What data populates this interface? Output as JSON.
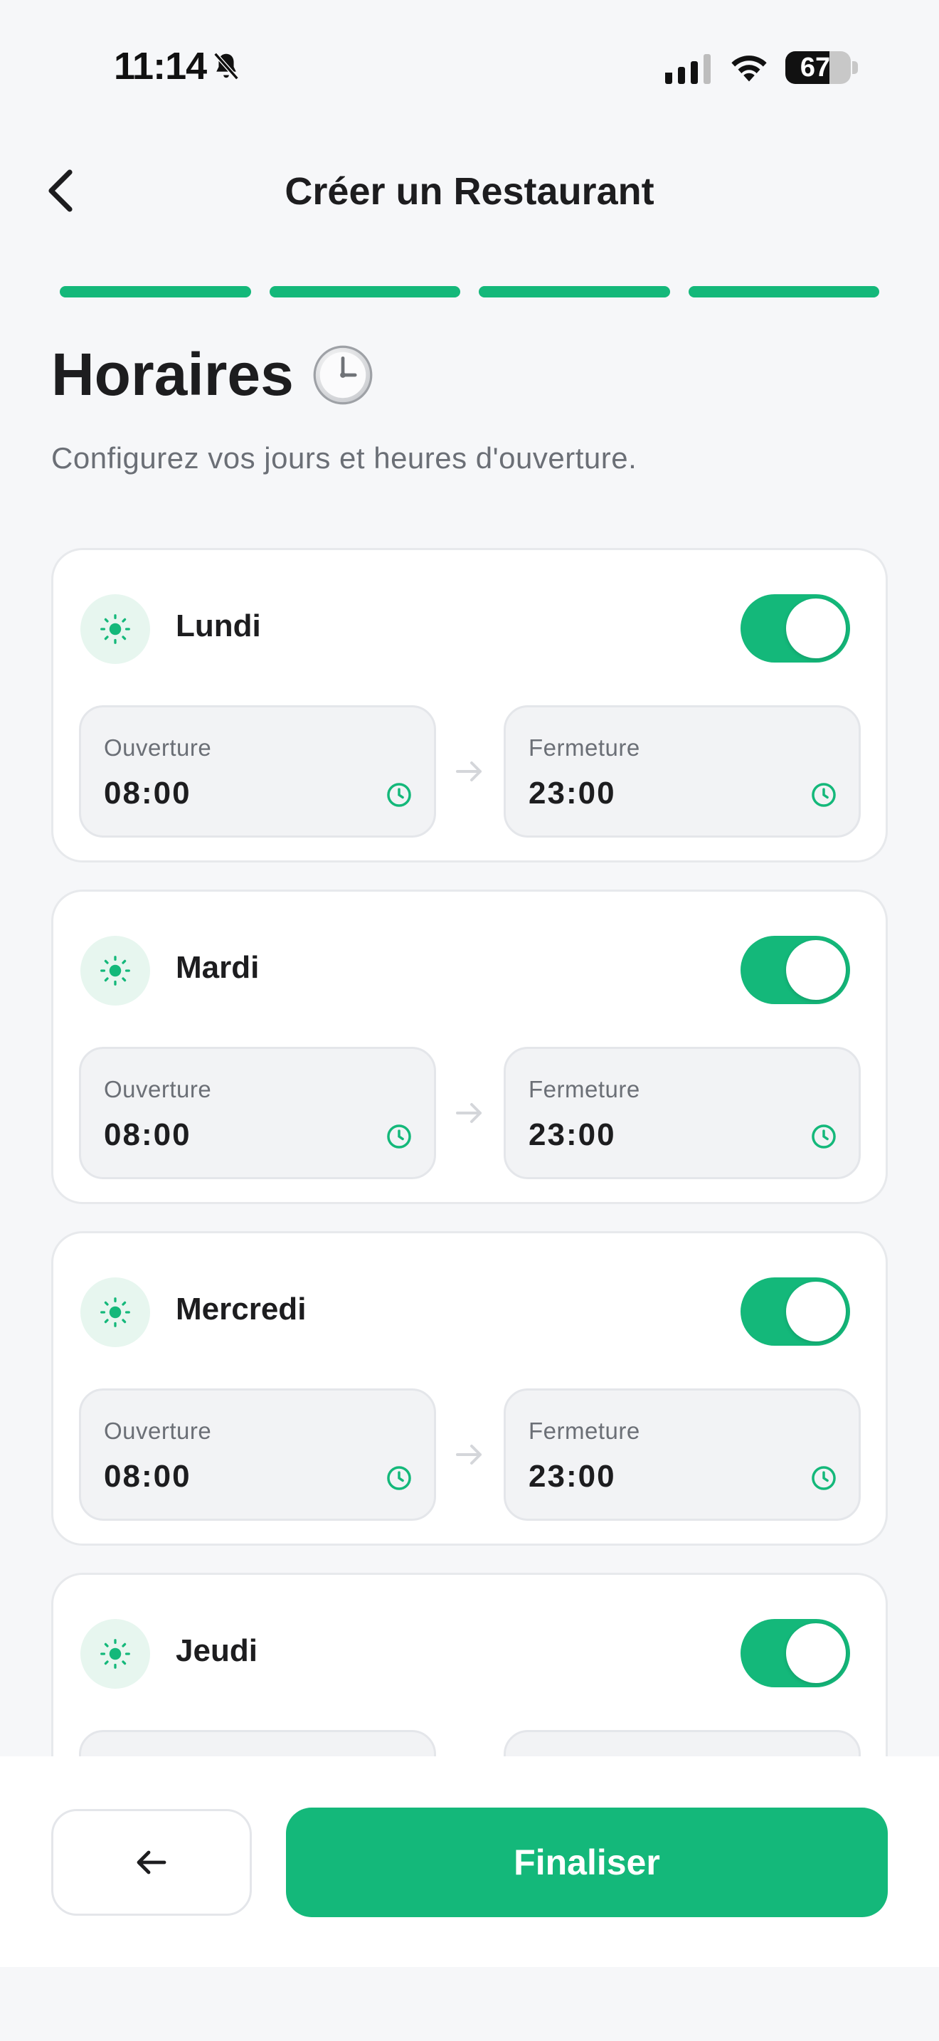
{
  "status_bar": {
    "time": "11:14",
    "battery": "67",
    "battery_level": 0.67
  },
  "header": {
    "title": "Créer un Restaurant",
    "progress_steps_total": 4,
    "progress_steps_done": 4
  },
  "section": {
    "title": "Horaires",
    "subtitle": "Configurez vos jours et heures d'ouverture."
  },
  "days": [
    {
      "name": "Lundi",
      "enabled": true,
      "open_label": "Ouverture",
      "open_time": "08:00",
      "close_label": "Fermeture",
      "close_time": "23:00"
    },
    {
      "name": "Mardi",
      "enabled": true,
      "open_label": "Ouverture",
      "open_time": "08:00",
      "close_label": "Fermeture",
      "close_time": "23:00"
    },
    {
      "name": "Mercredi",
      "enabled": true,
      "open_label": "Ouverture",
      "open_time": "08:00",
      "close_label": "Fermeture",
      "close_time": "23:00"
    },
    {
      "name": "Jeudi",
      "enabled": true,
      "open_label": "",
      "open_time": "",
      "close_label": "",
      "close_time": ""
    }
  ],
  "footer": {
    "finish_label": "Finaliser"
  },
  "colors": {
    "accent": "#14b87a",
    "accent_soft": "#e7f6ef",
    "background": "#f6f7f9"
  },
  "icons": {
    "back": "chevron-left-icon",
    "day": "sun-icon",
    "time_field": "clock-icon",
    "separator": "arrow-right-icon",
    "footer_back": "arrow-left-icon"
  }
}
